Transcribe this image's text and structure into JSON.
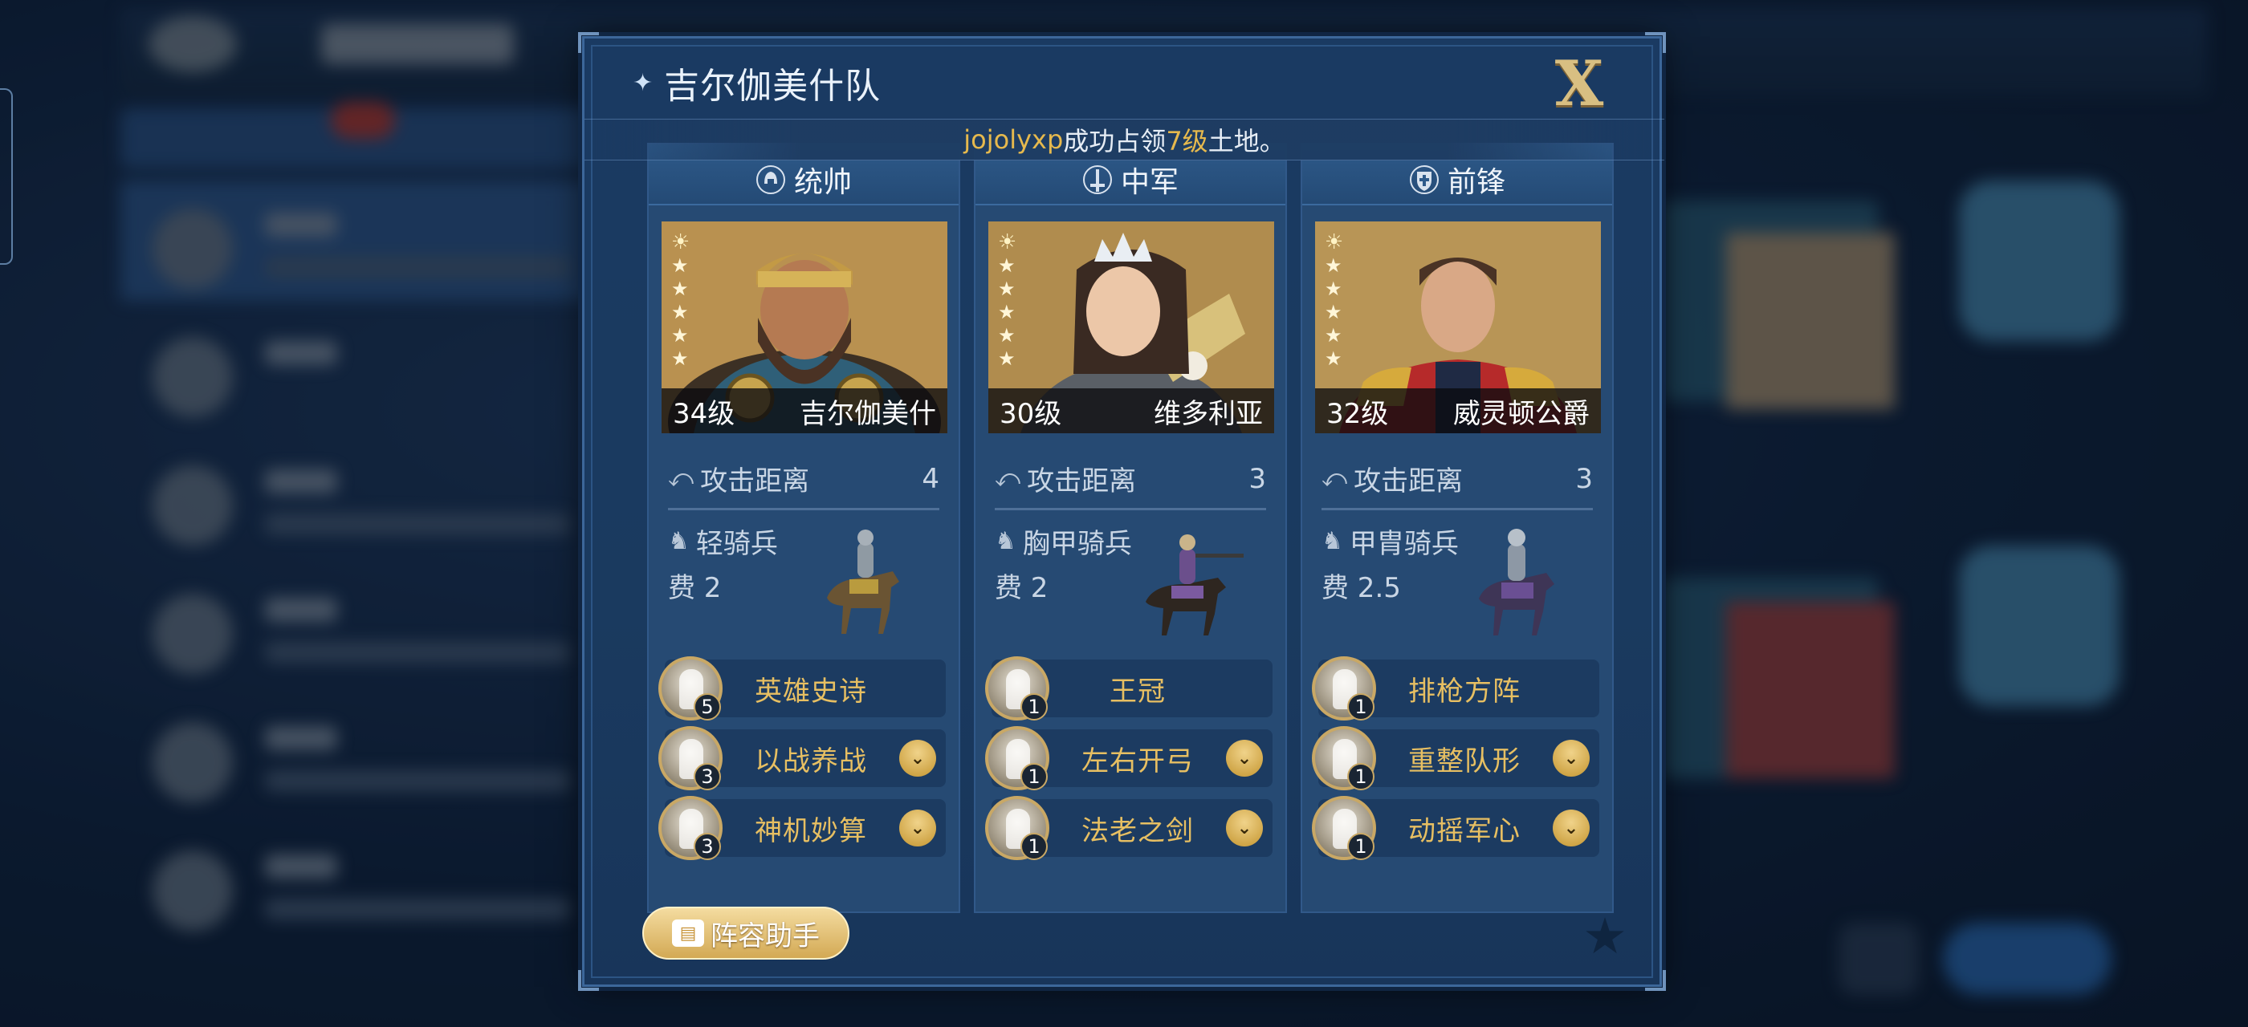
{
  "dialog": {
    "title": "吉尔伽美什队",
    "close_label": "X",
    "notice": {
      "player": "jojolyxp",
      "text1": "成功占领",
      "level": "7级",
      "text2": "土地。"
    },
    "helper_label": "阵容助手"
  },
  "columns": [
    {
      "role": "统帅",
      "role_icon": "helmet-icon",
      "level": "34级",
      "name": "吉尔伽美什",
      "stars": 5,
      "stat_label": "攻击距离",
      "stat_value": "4",
      "troop_type": "轻骑兵",
      "cost": "费 2",
      "skills": [
        {
          "name": "英雄史诗",
          "level": "5",
          "expandable": false
        },
        {
          "name": "以战养战",
          "level": "3",
          "expandable": true
        },
        {
          "name": "神机妙算",
          "level": "3",
          "expandable": true
        }
      ]
    },
    {
      "role": "中军",
      "role_icon": "sword-icon",
      "level": "30级",
      "name": "维多利亚",
      "stars": 5,
      "stat_label": "攻击距离",
      "stat_value": "3",
      "troop_type": "胸甲骑兵",
      "cost": "费 2",
      "skills": [
        {
          "name": "王冠",
          "level": "1",
          "expandable": false
        },
        {
          "name": "左右开弓",
          "level": "1",
          "expandable": true
        },
        {
          "name": "法老之剑",
          "level": "1",
          "expandable": true
        }
      ]
    },
    {
      "role": "前锋",
      "role_icon": "shield-icon",
      "level": "32级",
      "name": "威灵顿公爵",
      "stars": 5,
      "stat_label": "攻击距离",
      "stat_value": "3",
      "troop_type": "甲胄骑兵",
      "cost": "费 2.5",
      "skills": [
        {
          "name": "排枪方阵",
          "level": "1",
          "expandable": false
        },
        {
          "name": "重整队形",
          "level": "1",
          "expandable": true
        },
        {
          "name": "动摇军心",
          "level": "1",
          "expandable": true
        }
      ]
    }
  ],
  "colors": {
    "gold": "#e6b94d",
    "skill_gold": "#e7bf62",
    "panel": "#1a3a62"
  }
}
